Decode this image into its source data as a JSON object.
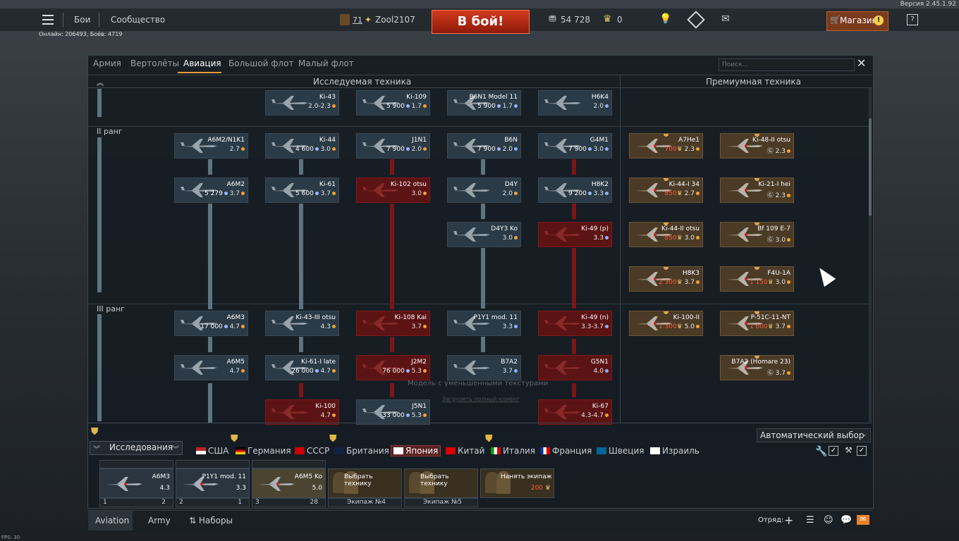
{
  "version": "Версия 2.45.1.92",
  "fps": "FPS: 30",
  "topbar": {
    "nav_battles": "Бои",
    "nav_community": "Сообщество",
    "player_level": "71",
    "player_name": "Zool2107",
    "battle_button": "В бой!",
    "silver": "54 728",
    "gold": "0",
    "shop": "Магазин",
    "help": "?"
  },
  "online_info": "Онлайн: 206493, Боёв: 4719",
  "panel": {
    "tabs": [
      "Армия",
      "Вертолёты",
      "Авиация",
      "Большой флот",
      "Малый флот"
    ],
    "active_tab": "Авиация",
    "search_placeholder": "Поиск...",
    "section_research": "Исследуемая техника",
    "section_premium": "Премиумная техника",
    "rank2": "II ранг",
    "rank3": "III ранг",
    "auto_select": "Автоматический выбор",
    "overlay_text": "Модель с уменьшенными текстурами",
    "overlay_link": "Загрузить полный клиент"
  },
  "cards": [
    {
      "name": "Ki-43",
      "price": "",
      "br": "2.0-2.3",
      "style": "normal",
      "mark": "dot"
    },
    {
      "name": "Ki-109",
      "price": "5 900",
      "br": "1.7",
      "style": "normal",
      "mark": "dot"
    },
    {
      "name": "B6N1 Model 11",
      "price": "5 900",
      "br": "1.7",
      "style": "normal",
      "mark": "blue"
    },
    {
      "name": "H6K4",
      "price": "",
      "br": "2.0",
      "style": "normal",
      "mark": "blue"
    },
    {
      "name": "A6M2/N1K1",
      "price": "",
      "br": "2.7",
      "style": "normal",
      "mark": "dot"
    },
    {
      "name": "Ki-44",
      "price": "4 600",
      "br": "3.0",
      "style": "normal",
      "mark": "dot"
    },
    {
      "name": "J1N1",
      "price": "7 900",
      "br": "2.0",
      "style": "normal",
      "mark": "dot"
    },
    {
      "name": "B6N",
      "price": "7 900",
      "br": "2.0",
      "style": "normal",
      "mark": "blue"
    },
    {
      "name": "G4M1",
      "price": "7 900",
      "br": "3.0",
      "style": "normal",
      "mark": "blue"
    },
    {
      "name": "A6M2",
      "price": "5 279",
      "br": "3.7",
      "style": "normal",
      "mark": "dot"
    },
    {
      "name": "Ki-61",
      "price": "5 600",
      "br": "3.7",
      "style": "normal",
      "mark": "dot"
    },
    {
      "name": "Ki-102 otsu",
      "price": "",
      "br": "3.0",
      "style": "red",
      "mark": "dot"
    },
    {
      "name": "D4Y",
      "price": "",
      "br": "2.0",
      "style": "normal",
      "mark": "dot"
    },
    {
      "name": "H8K2",
      "price": "9 200",
      "br": "3.3",
      "style": "normal",
      "mark": "blue"
    },
    {
      "name": "D4Y3 Ko",
      "price": "",
      "br": "3.0",
      "style": "normal",
      "mark": "dot"
    },
    {
      "name": "Ki-49 (p)",
      "price": "",
      "br": "3.3",
      "style": "red",
      "mark": "blue"
    },
    {
      "name": "A6M3",
      "price": "17 000",
      "br": "4.7",
      "style": "normal",
      "mark": "dot"
    },
    {
      "name": "Ki-43-III otsu",
      "price": "",
      "br": "4.3",
      "style": "normal",
      "mark": "dot"
    },
    {
      "name": "Ki-108 Kai",
      "price": "",
      "br": "3.7",
      "style": "red",
      "mark": "dot"
    },
    {
      "name": "P1Y1 mod. 11",
      "price": "",
      "br": "3.3",
      "style": "normal",
      "mark": "blue"
    },
    {
      "name": "Ki-49 (n)",
      "price": "",
      "br": "3.3-3.7",
      "style": "red",
      "mark": "blue"
    },
    {
      "name": "A6M5",
      "price": "",
      "br": "4.7",
      "style": "normal",
      "mark": "dot"
    },
    {
      "name": "Ki-61-I late",
      "price": "26 000",
      "br": "4.7",
      "style": "normal",
      "mark": "dot"
    },
    {
      "name": "J2M2",
      "price": "76 000",
      "br": "5.3",
      "style": "red",
      "mark": "dot"
    },
    {
      "name": "B7A2",
      "price": "",
      "br": "3.7",
      "style": "normal",
      "mark": "blue"
    },
    {
      "name": "G5N1",
      "price": "",
      "br": "4.0",
      "style": "red",
      "mark": "blue"
    },
    {
      "name": "Ki-100",
      "price": "",
      "br": "4.7",
      "style": "red",
      "mark": "dot"
    },
    {
      "name": "J5N1",
      "price": "33 000",
      "br": "5.3",
      "style": "normal",
      "mark": "dot"
    },
    {
      "name": "Ki-67",
      "price": "",
      "br": "4.3-4.7",
      "style": "red",
      "mark": "dot"
    }
  ],
  "premium": [
    {
      "name": "A7He1",
      "price": "700",
      "br": "2.3"
    },
    {
      "name": "Ki-48-II otsu",
      "price": "",
      "br": "2.3"
    },
    {
      "name": "Ki-44-I 34",
      "price": "850",
      "br": "2.7"
    },
    {
      "name": "Ki-21-I hei",
      "price": "",
      "br": "2.3"
    },
    {
      "name": "Ki-44-II otsu",
      "price": "850",
      "br": "3.0"
    },
    {
      "name": "Bf 109 E-7",
      "price": "",
      "br": "3.0"
    },
    {
      "name": "H8K3",
      "price": "2 300",
      "br": "3.7"
    },
    {
      "name": "F4U-1A",
      "price": "1 150",
      "br": "3.0"
    },
    {
      "name": "Ki-100-II",
      "price": "1 300",
      "br": "5.0"
    },
    {
      "name": "P-51C-11-NT",
      "price": "1 600",
      "br": "3.7"
    },
    {
      "name": "B7A2 (Homare 23)",
      "price": "",
      "br": "3.7"
    }
  ],
  "countries": [
    "США",
    "Германия",
    "СССР",
    "Британия",
    "Япония",
    "Китай",
    "Италия",
    "Франция",
    "Швеция",
    "Израиль"
  ],
  "active_country": "Япония",
  "research_label": "Исследования",
  "crew": [
    {
      "name": "A6M3",
      "br": "4.3",
      "slot": "1",
      "count": "2"
    },
    {
      "name": "P1Y1 mod. 11",
      "br": "3.3",
      "slot": "2",
      "count": "1"
    },
    {
      "name": "A6M5 Ko",
      "br": "5.0",
      "slot": "3",
      "count": "28",
      "extra": "3"
    },
    {
      "name": "Выбрать технику",
      "label": "Экипаж №4"
    },
    {
      "name": "Выбрать технику",
      "label": "Экипаж №5"
    },
    {
      "name": "Нанять экипаж",
      "price": "200"
    }
  ],
  "footer": {
    "tab1": "Aviation",
    "tab2": "Army",
    "presets": "Наборы",
    "squad": "Отряд:"
  }
}
